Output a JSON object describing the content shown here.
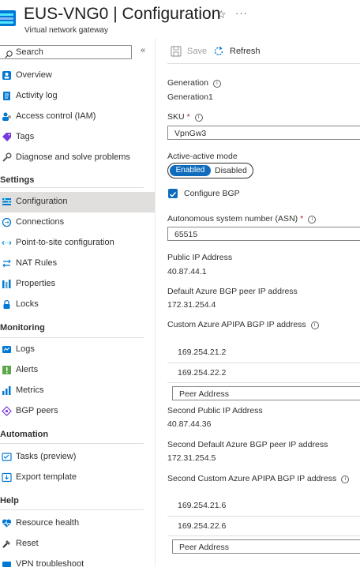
{
  "header": {
    "title": "EUS-VNG0 | Configuration",
    "subtitle": "Virtual network gateway",
    "more": "···"
  },
  "search": {
    "placeholder": "Search"
  },
  "nav": {
    "top_items": [
      {
        "label": "Overview",
        "icon": "overview-icon"
      },
      {
        "label": "Activity log",
        "icon": "activity-log-icon"
      },
      {
        "label": "Access control (IAM)",
        "icon": "iam-icon"
      },
      {
        "label": "Tags",
        "icon": "tag-icon"
      },
      {
        "label": "Diagnose and solve problems",
        "icon": "wrench-icon"
      }
    ],
    "settings_header": "Settings",
    "settings_items": [
      {
        "label": "Configuration",
        "icon": "configuration-icon",
        "selected": true
      },
      {
        "label": "Connections",
        "icon": "connections-icon"
      },
      {
        "label": "Point-to-site configuration",
        "icon": "point-to-site-icon"
      },
      {
        "label": "NAT Rules",
        "icon": "nat-rules-icon"
      },
      {
        "label": "Properties",
        "icon": "properties-icon"
      },
      {
        "label": "Locks",
        "icon": "lock-icon"
      }
    ],
    "monitoring_header": "Monitoring",
    "monitoring_items": [
      {
        "label": "Logs",
        "icon": "logs-icon"
      },
      {
        "label": "Alerts",
        "icon": "alerts-icon"
      },
      {
        "label": "Metrics",
        "icon": "metrics-icon"
      },
      {
        "label": "BGP peers",
        "icon": "bgp-peers-icon"
      }
    ],
    "automation_header": "Automation",
    "automation_items": [
      {
        "label": "Tasks (preview)",
        "icon": "tasks-icon"
      },
      {
        "label": "Export template",
        "icon": "export-template-icon"
      }
    ],
    "help_header": "Help",
    "help_items": [
      {
        "label": "Resource health",
        "icon": "resource-health-icon"
      },
      {
        "label": "Reset",
        "icon": "reset-icon"
      },
      {
        "label": "VPN troubleshoot",
        "icon": "vpn-troubleshoot-icon"
      }
    ]
  },
  "toolbar": {
    "save_label": "Save",
    "refresh_label": "Refresh"
  },
  "form": {
    "generation_label": "Generation",
    "generation_value": "Generation1",
    "sku_label": "SKU",
    "sku_value": "VpnGw3",
    "active_active_label": "Active-active mode",
    "toggle_enabled": "Enabled",
    "toggle_disabled": "Disabled",
    "configure_bgp_label": "Configure BGP",
    "configure_bgp_checked": true,
    "asn_label": "Autonomous system number (ASN)",
    "asn_value": "65515",
    "public_ip_label": "Public IP Address",
    "public_ip_value": "40.87.44.1",
    "default_bgp_label": "Default Azure BGP peer IP address",
    "default_bgp_value": "172.31.254.4",
    "custom_apipa_label": "Custom Azure APIPA BGP IP address",
    "custom_apipa_values": [
      "169.254.21.2",
      "169.254.22.2"
    ],
    "peer_placeholder": "Peer Address",
    "second_public_ip_label": "Second Public IP Address",
    "second_public_ip_value": "40.87.44.36",
    "second_default_bgp_label": "Second Default Azure BGP peer IP address",
    "second_default_bgp_value": "172.31.254.5",
    "second_custom_apipa_label": "Second Custom Azure APIPA BGP IP address",
    "second_custom_apipa_values": [
      "169.254.21.6",
      "169.254.22.6"
    ],
    "second_peer_placeholder": "Peer Address"
  },
  "colors": {
    "accent": "#0f6cbd",
    "required": "#a4262c",
    "selected_bg": "#e1dfdd"
  }
}
